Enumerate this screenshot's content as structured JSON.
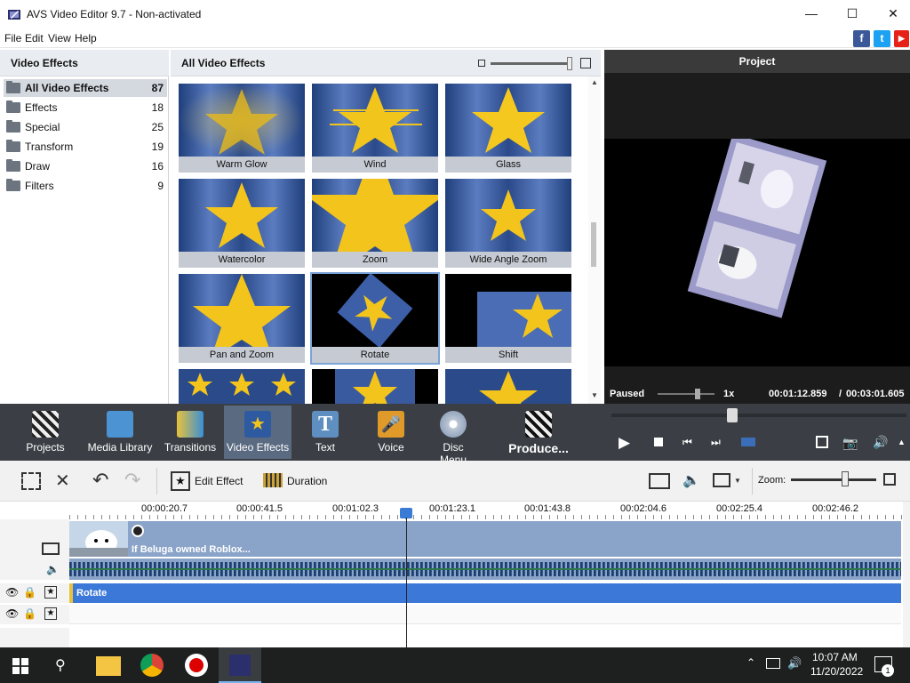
{
  "window": {
    "title": "AVS Video Editor 9.7 - Non-activated"
  },
  "menu": [
    "File",
    "Edit",
    "View",
    "Help"
  ],
  "social": [
    {
      "name": "facebook-icon",
      "glyph": "f",
      "color": "#3b5998"
    },
    {
      "name": "twitter-icon",
      "glyph": "t",
      "color": "#1da1f2"
    },
    {
      "name": "youtube-icon",
      "glyph": "▶",
      "color": "#e62117"
    }
  ],
  "left_panel": {
    "title": "Video Effects",
    "categories": [
      {
        "label": "All Video Effects",
        "count": "87",
        "selected": true
      },
      {
        "label": "Effects",
        "count": "18"
      },
      {
        "label": "Special",
        "count": "25"
      },
      {
        "label": "Transform",
        "count": "19"
      },
      {
        "label": "Draw",
        "count": "16"
      },
      {
        "label": "Filters",
        "count": "9"
      }
    ]
  },
  "mid_panel": {
    "title": "All Video Effects",
    "effects": [
      "Warm Glow",
      "Wind",
      "Glass",
      "Watercolor",
      "Zoom",
      "Wide Angle Zoom",
      "Pan and Zoom",
      "Rotate",
      "Shift"
    ]
  },
  "preview": {
    "title": "Project",
    "status": "Paused",
    "speed": "1x",
    "current_time": "00:01:12.859",
    "separator": "/",
    "total_time": "00:03:01.605"
  },
  "toolbar": {
    "buttons": [
      "Projects",
      "Media Library",
      "Transitions",
      "Video Effects",
      "Text",
      "Voice",
      "Disc Menu",
      "Produce..."
    ],
    "selected": "Video Effects"
  },
  "timeline_toolbar": {
    "edit_effect": "Edit Effect",
    "duration": "Duration",
    "zoom_label": "Zoom:"
  },
  "timeline": {
    "ticks": [
      "00:00:20.7",
      "00:00:41.5",
      "00:01:02.3",
      "00:01:23.1",
      "00:01:43.8",
      "00:02:04.6",
      "00:02:25.4",
      "00:02:46.2"
    ],
    "clip_title": "If Beluga owned Roblox...",
    "effect_clip": "Rotate"
  },
  "taskbar": {
    "time": "10:07 AM",
    "date": "11/20/2022",
    "notifications": "1"
  }
}
